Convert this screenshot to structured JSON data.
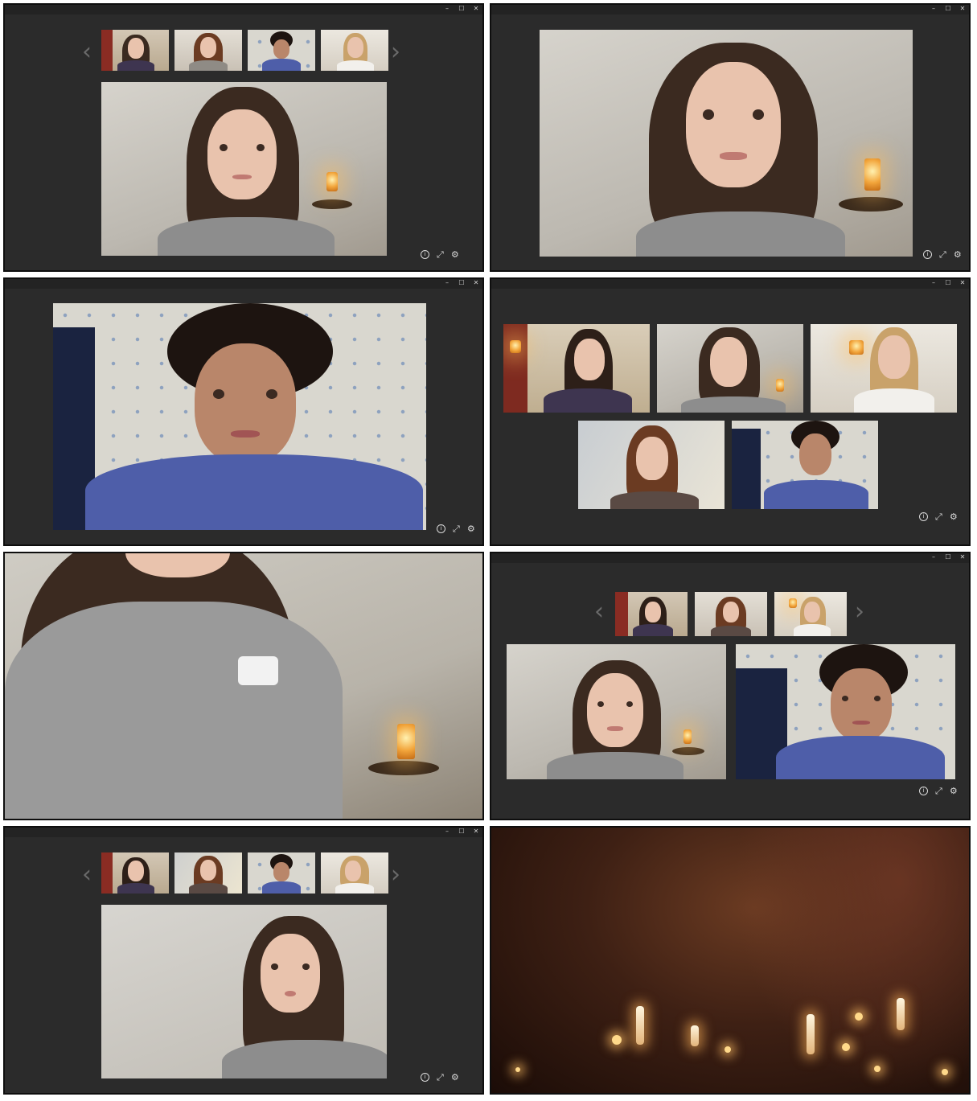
{
  "window_controls": {
    "minimize": "–",
    "maximize": "☐",
    "close": "✕"
  },
  "nav": {
    "prev": "‹",
    "next": "›"
  },
  "video_controls": {
    "info": "i",
    "expand": "⤢",
    "settings": "⚙"
  },
  "icons": [
    "info-icon",
    "expand-icon",
    "gear-icon",
    "chevron-left-icon",
    "chevron-right-icon",
    "minimize-icon",
    "maximize-icon",
    "close-icon"
  ],
  "colors": {
    "window_bg": "#2b2b2b",
    "titlebar": "#232323",
    "sweater_blue": "#4e5ea9",
    "sweater_grey": "#8d8d8d",
    "lamp": "#f2a53b"
  }
}
